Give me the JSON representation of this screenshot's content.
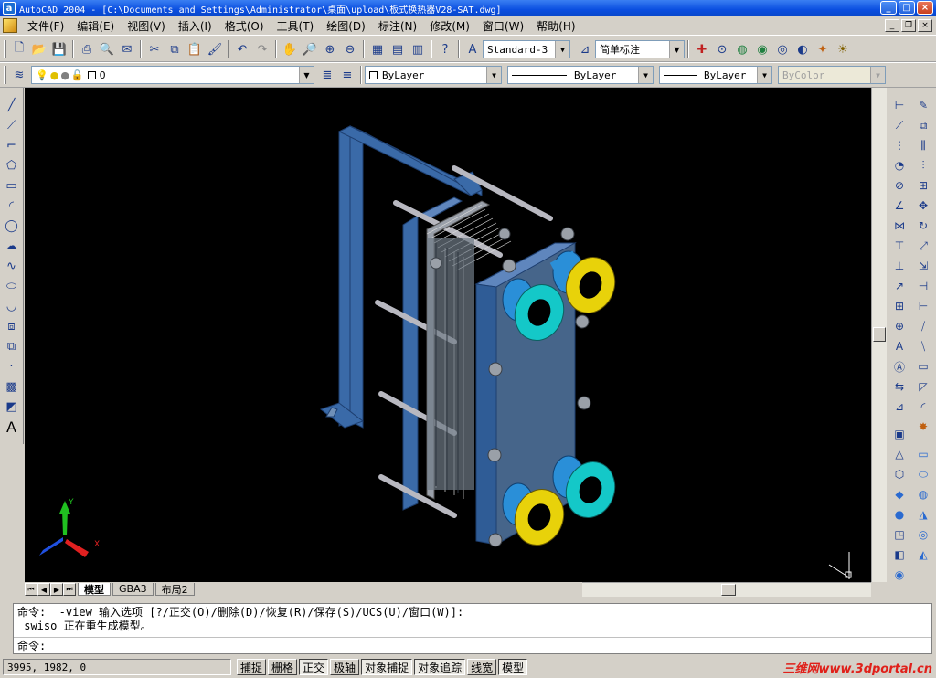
{
  "titlebar": {
    "title": "AutoCAD 2004 - [C:\\Documents and Settings\\Administrator\\桌面\\upload\\板式换热器V28-SAT.dwg]",
    "app_icon_letter": "a",
    "min": "_",
    "max": "□",
    "close": "×"
  },
  "menus": [
    "文件(F)",
    "编辑(E)",
    "视图(V)",
    "插入(I)",
    "格式(O)",
    "工具(T)",
    "绘图(D)",
    "标注(N)",
    "修改(M)",
    "窗口(W)",
    "帮助(H)"
  ],
  "doc_buttons": {
    "min": "_",
    "restore": "❐",
    "close": "×"
  },
  "toolbar_standard": {
    "text_style": "Standard-3",
    "dim_style": "简单标注"
  },
  "toolbar_layers": {
    "layer": "0",
    "color": "ByLayer",
    "linetype": "ByLayer",
    "lineweight": "ByLayer",
    "plotstyle": "ByColor"
  },
  "layout_tabs": [
    "模型",
    "GBA3",
    "布局2"
  ],
  "ucs": {
    "x": "X",
    "y": "Y"
  },
  "command": {
    "line1": "命令: _-view 输入选项 [?/正交(O)/删除(D)/恢复(R)/保存(S)/UCS(U)/窗口(W)]:",
    "line2": "_swiso 正在重生成模型。",
    "prompt": "命令:"
  },
  "status": {
    "coords": "3995, 1982, 0",
    "buttons": [
      {
        "label": "捕捉",
        "on": false
      },
      {
        "label": "栅格",
        "on": false
      },
      {
        "label": "正交",
        "on": true
      },
      {
        "label": "极轴",
        "on": false
      },
      {
        "label": "对象捕捉",
        "on": true
      },
      {
        "label": "对象追踪",
        "on": true
      },
      {
        "label": "线宽",
        "on": false
      },
      {
        "label": "模型",
        "on": true
      }
    ]
  },
  "watermark": "三维网www.3dportal.cn",
  "colors": {
    "frame": "#3a6aa8",
    "plate": "#46658a",
    "nozzle_blue": "#2a8fd8",
    "flange_cyan": "#14c8c8",
    "flange_yellow": "#e8d20a"
  }
}
